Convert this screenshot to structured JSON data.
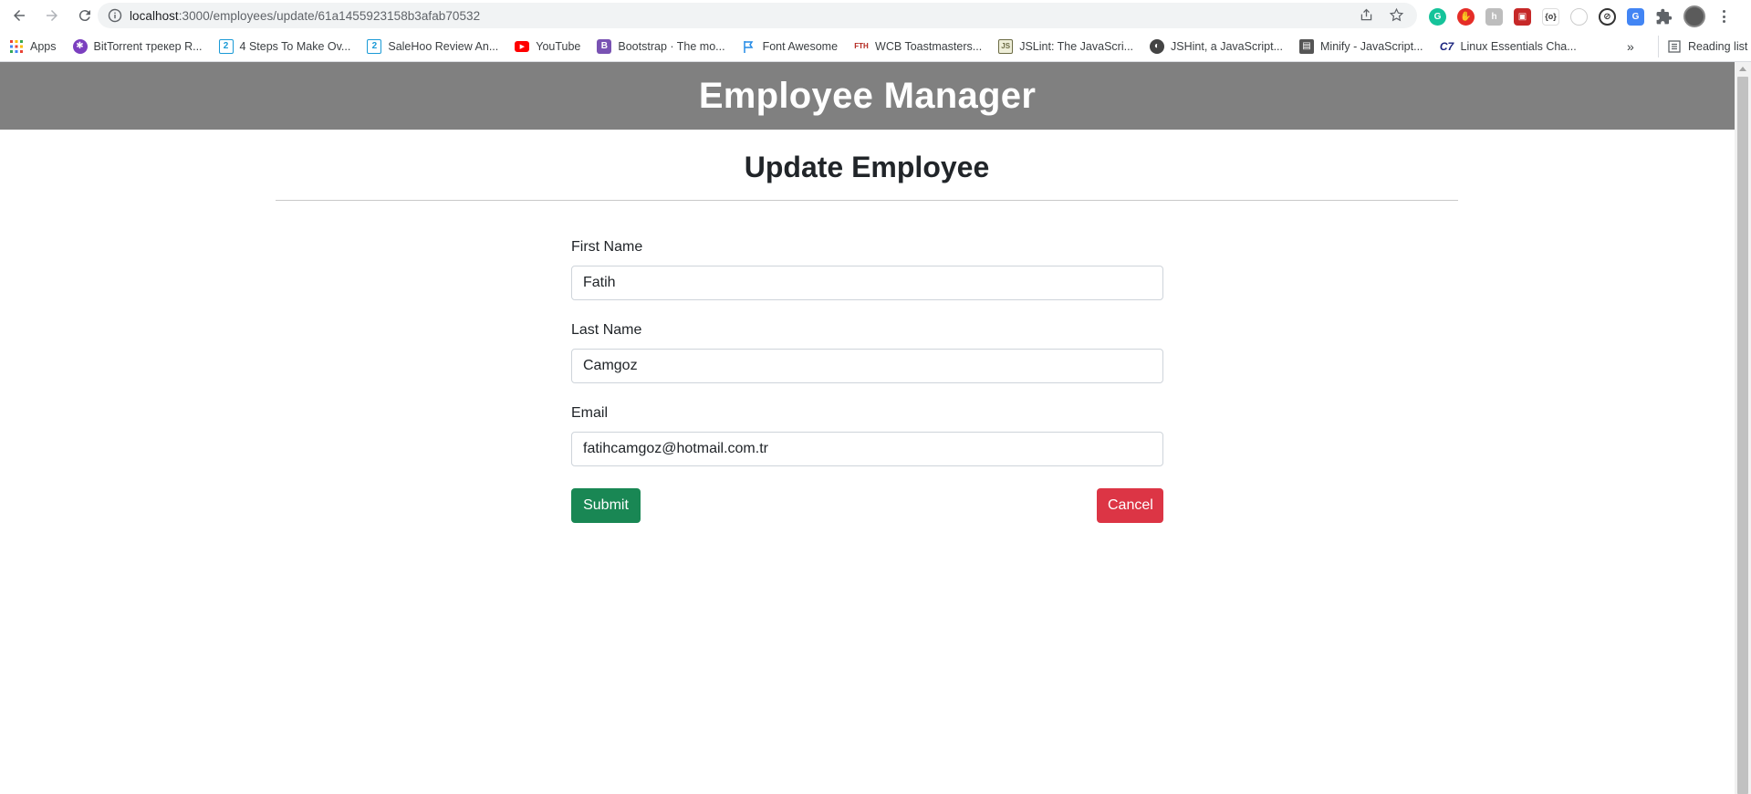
{
  "browser": {
    "url_host": "localhost",
    "url_path": ":3000/employees/update/61a1455923158b3afab70532",
    "bookmarks": [
      {
        "label": "Apps",
        "icon": "apps-grid-icon",
        "color": "#ea4335"
      },
      {
        "label": "BitTorrent трекер R...",
        "icon": "bittorrent-icon",
        "color": "#7b3fbf"
      },
      {
        "label": "4 Steps To Make Ov...",
        "icon": "salehoo-icon",
        "color": "#1a9ad6"
      },
      {
        "label": "SaleHoo Review An...",
        "icon": "salehoo-icon",
        "color": "#1a9ad6"
      },
      {
        "label": "YouTube",
        "icon": "youtube-icon",
        "color": "#ff0000"
      },
      {
        "label": "Bootstrap · The mo...",
        "icon": "bootstrap-icon",
        "color": "#7952b3"
      },
      {
        "label": "Font Awesome",
        "icon": "flag-icon",
        "color": "#228ae6"
      },
      {
        "label": "WCB Toastmasters...",
        "icon": "fth-icon",
        "color": "#b3261e"
      },
      {
        "label": "JSLint: The JavaScri...",
        "icon": "jslint-icon",
        "color": "#6b6b44"
      },
      {
        "label": "JSHint, a JavaScript...",
        "icon": "jshint-icon",
        "color": "#444444"
      },
      {
        "label": "Minify - JavaScript...",
        "icon": "minify-icon",
        "color": "#555555"
      },
      {
        "label": "Linux Essentials Cha...",
        "icon": "c7-icon",
        "color": "#1a237e"
      }
    ],
    "reading_list": "Reading list"
  },
  "header": {
    "title": "Employee Manager"
  },
  "page": {
    "title": "Update Employee"
  },
  "form": {
    "first_name": {
      "label": "First Name",
      "value": "Fatih"
    },
    "last_name": {
      "label": "Last Name",
      "value": "Camgoz"
    },
    "email": {
      "label": "Email",
      "value": "fatihcamgoz@hotmail.com.tr"
    },
    "submit_label": "Submit",
    "cancel_label": "Cancel"
  },
  "colors": {
    "header_bg": "#808080",
    "submit": "#198754",
    "cancel": "#dc3545"
  }
}
